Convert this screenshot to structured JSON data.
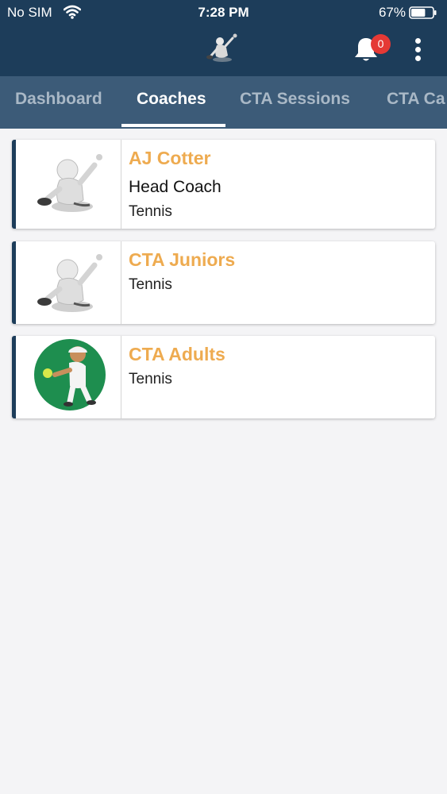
{
  "status_bar": {
    "carrier": "No SIM",
    "time": "7:28 PM",
    "battery": "67%",
    "battery_level": 0.67
  },
  "header": {
    "logo_icon": "tennis-player-logo-icon",
    "notification_count": "0"
  },
  "tabs": [
    {
      "label": "Dashboard",
      "active": false
    },
    {
      "label": "Coaches",
      "active": true
    },
    {
      "label": "CTA Sessions",
      "active": false
    },
    {
      "label": "CTA Ca",
      "active": false
    }
  ],
  "coaches": [
    {
      "name": "AJ Cotter",
      "title": "Head Coach",
      "sport": "Tennis",
      "avatar_icon": "tennis-figure-icon"
    },
    {
      "name": "CTA Juniors",
      "sport": "Tennis",
      "avatar_icon": "tennis-figure-icon"
    },
    {
      "name": "CTA Adults",
      "sport": "Tennis",
      "avatar_icon": "tennis-player-cartoon-icon"
    }
  ],
  "colors": {
    "header_bg": "#1d3d5a",
    "tabbar_bg": "#3c5b78",
    "name_accent": "#eeab50",
    "badge": "#e53935"
  }
}
